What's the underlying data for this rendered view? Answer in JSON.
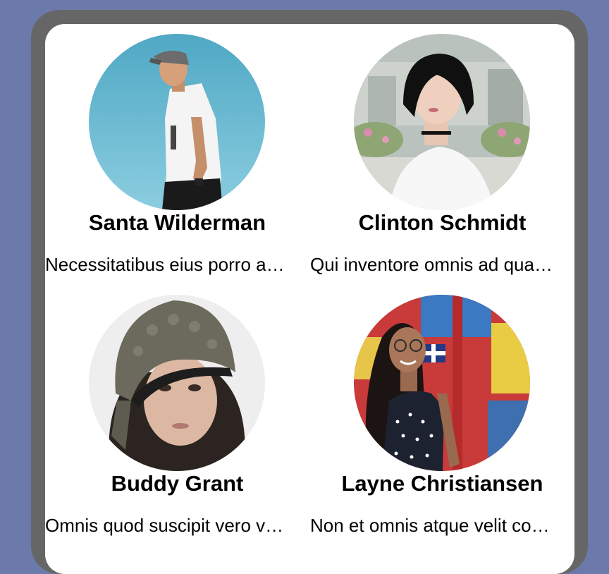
{
  "people": [
    {
      "name": "Santa Wilderman",
      "bio": "Necessitatibus eius porro a…",
      "avatar": "photo-man-cap-white-tshirt-sky"
    },
    {
      "name": "Clinton Schmidt",
      "bio": "Qui inventore omnis ad qua…",
      "avatar": "photo-woman-short-black-hair"
    },
    {
      "name": "Buddy Grant",
      "bio": "Omnis quod suscipit vero v…",
      "avatar": "photo-woman-knit-hat"
    },
    {
      "name": "Layne Christiansen",
      "bio": "Non et omnis atque velit co…",
      "avatar": "photo-woman-polka-dot-dress"
    }
  ],
  "colors": {
    "background": "#6b7aaa",
    "frame": "#666666",
    "screen": "#ffffff"
  }
}
